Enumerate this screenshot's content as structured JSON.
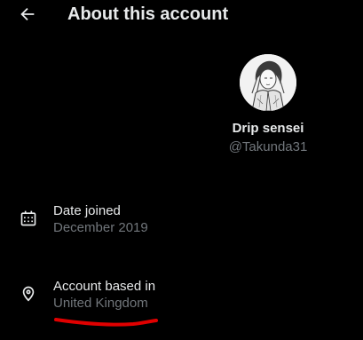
{
  "header": {
    "back_icon": "arrow-left-icon",
    "title": "About this account"
  },
  "profile": {
    "avatar": "avatar-illustration",
    "display_name": "Drip sensei",
    "handle": "@Takunda31"
  },
  "details": [
    {
      "icon": "calendar-icon",
      "label": "Date joined",
      "value": "December 2019"
    },
    {
      "icon": "location-pin-icon",
      "label": "Account based in",
      "value": "United Kingdom"
    }
  ],
  "colors": {
    "background": "#000000",
    "primary_text": "#e7e9ea",
    "secondary_text": "#71767b",
    "annotation": "#e00000"
  }
}
